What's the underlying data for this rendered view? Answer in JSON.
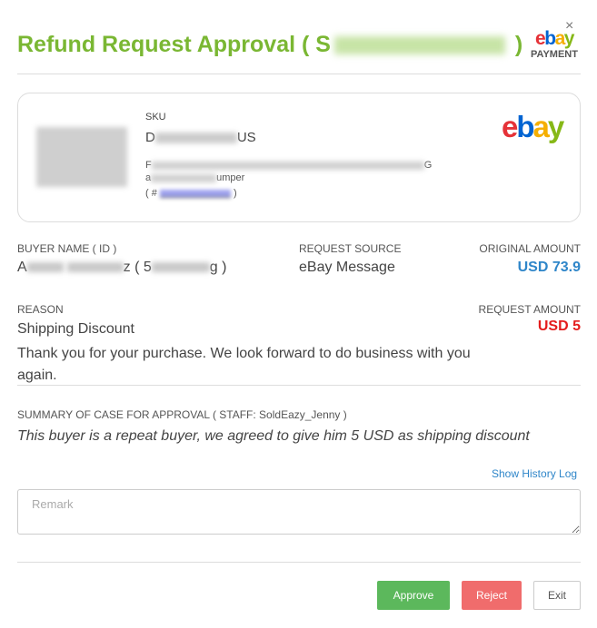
{
  "dialog": {
    "title_prefix": "Refund Request Approval ( S",
    "title_suffix": " )",
    "close_glyph": "×",
    "logo_letters": [
      "e",
      "b",
      "a",
      "y"
    ],
    "logo_sub": "PAYMENT"
  },
  "product": {
    "sku_label": "SKU",
    "sku_value_visible": "D",
    "sku_value_tail": "US",
    "line1_prefix": "F",
    "line1_suffix": "G",
    "line2_prefix": "a",
    "line2_suffix": "umper",
    "order_prefix": "( # ",
    "order_suffix": " )",
    "marketplace_logo": [
      "e",
      "b",
      "a",
      "y"
    ]
  },
  "details": {
    "buyer_label": "BUYER NAME ( ID )",
    "buyer_prefix": "A",
    "buyer_mid": "z ( 5",
    "buyer_suffix": "g )",
    "source_label": "REQUEST SOURCE",
    "source_value": "eBay Message",
    "original_label": "ORIGINAL AMOUNT",
    "original_value": "USD 73.9",
    "reason_label": "REASON",
    "reason_title": "Shipping Discount",
    "reason_body": "Thank you for your purchase. We look forward to do business with you again.",
    "request_label": "REQUEST AMOUNT",
    "request_value": "USD 5"
  },
  "summary": {
    "label": "SUMMARY OF CASE FOR APPROVAL ( STAFF: SoldEazy_Jenny )",
    "text": "This buyer is a repeat buyer, we agreed to give him 5 USD as shipping discount"
  },
  "history_link": "Show History Log",
  "remark": {
    "placeholder": "Remark",
    "value": ""
  },
  "buttons": {
    "approve": "Approve",
    "reject": "Reject",
    "exit": "Exit"
  },
  "colors": {
    "title": "#7ab733",
    "original_amount": "#2f86c9",
    "request_amount": "#e41c1c",
    "approve": "#5cb85c",
    "reject": "#f06c6c",
    "link": "#2f86c9"
  }
}
